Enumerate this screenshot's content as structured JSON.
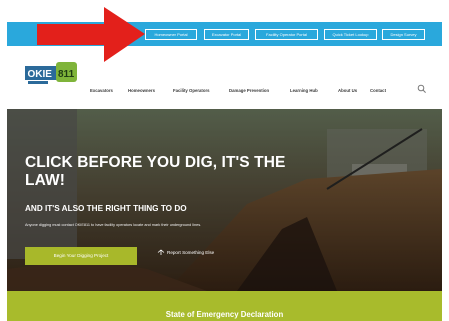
{
  "portals": [
    "Homeowner Portal",
    "Excavator Portal",
    "Facility Operator Portal",
    "Quick Ticket Lookup",
    "Design Survey"
  ],
  "logo": {
    "text": "OKIE811"
  },
  "nav": {
    "items": [
      "Excavators",
      "Homeowners",
      "Facility Operators",
      "Damage Prevention",
      "Learning Hub",
      "About Us",
      "Contact"
    ]
  },
  "hero": {
    "title": "CLICK BEFORE YOU DIG, IT'S THE LAW!",
    "subtitle": "AND IT'S ALSO THE RIGHT THING TO DO",
    "body": "Anyone digging must contact OKIE811 to have facility operators locate and mark their underground lines.",
    "cta_label": "Begin Your Digging Project",
    "report_label": "Report Something Else"
  },
  "banner": {
    "text": "State of Emergency Declaration"
  },
  "colors": {
    "topbar": "#2aa8dc",
    "accent_green": "#a8b82a",
    "arrow_red": "#e3201b"
  },
  "icons": [
    "search-icon",
    "arrow-annotation",
    "report-icon"
  ]
}
